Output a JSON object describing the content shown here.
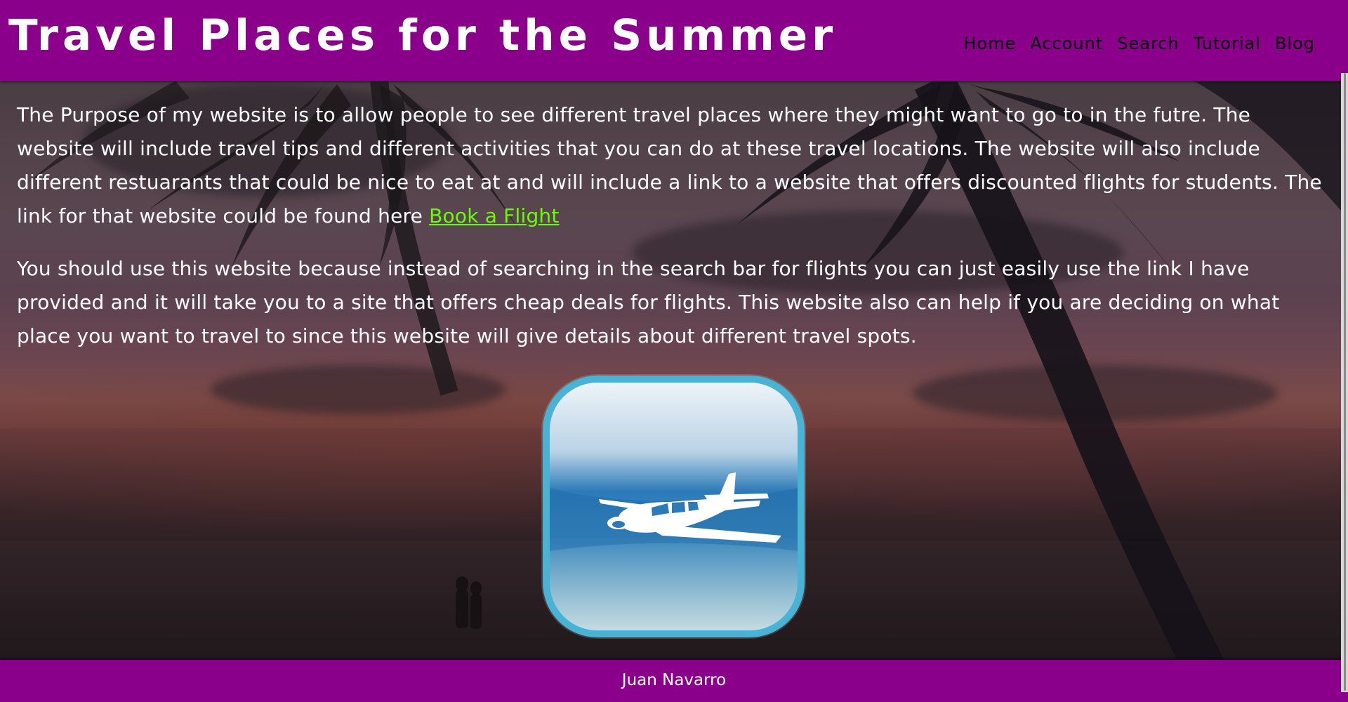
{
  "header": {
    "title": "Travel Places for the Summer",
    "background_color": "#8b008b",
    "nav": [
      {
        "label": "Home"
      },
      {
        "label": "Account"
      },
      {
        "label": "Search"
      },
      {
        "label": "Tutorial"
      },
      {
        "label": "Blog"
      }
    ]
  },
  "main": {
    "paragraph1": {
      "text": "The Purpose of my website is to allow people to see different travel places where they might want to go to in the futre. The website will include travel tips and different activities that you can do at these travel locations. The website will also include different restuarants that could be nice to eat at and will include a link to a website that offers discounted flights for students. The link for that website could be found here ",
      "link_label": "Book a Flight",
      "link_color": "#66ff00"
    },
    "paragraph2": {
      "text": "You should use this website because instead of searching in the search bar for flights you can just easily use the link I have provided and it will take you to a site that offers cheap deals for flights. This website also can help if you are deciding on what place you want to travel to since this website will give details about different travel spots."
    },
    "image": {
      "icon": "airplane-app-icon",
      "border_color": "#49b3d6"
    },
    "background": {
      "icon": "tropical-sunset-palm-trees-image"
    }
  },
  "footer": {
    "author": "Juan Navarro",
    "background_color": "#8b008b"
  }
}
